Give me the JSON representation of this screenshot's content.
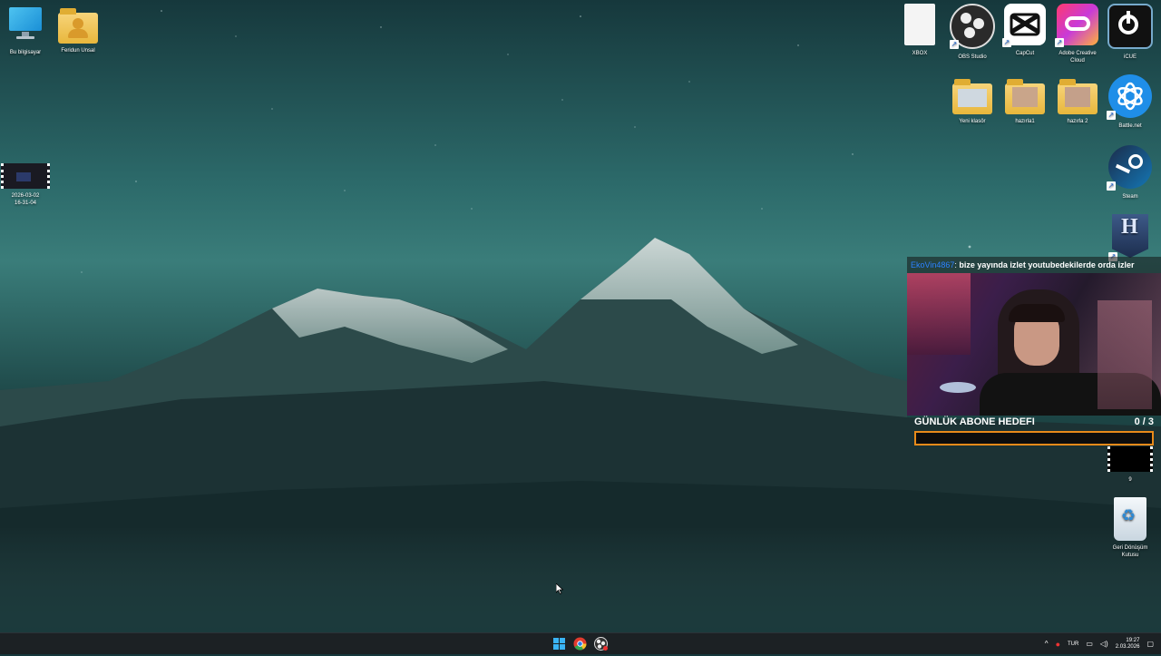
{
  "desktop": {
    "left_icons": [
      {
        "label": "Bu bilgisayar",
        "icon": "monitor-icon"
      },
      {
        "label": "Feridun Unsal",
        "icon": "user-folder-icon"
      },
      {
        "label_line1": "2026-03-02",
        "label_line2": "16-31-04",
        "icon": "video-thumbnail-icon"
      }
    ],
    "right_icons": {
      "xbox": "XBOX",
      "obs": "OBS Studio",
      "capcut": "CapCut",
      "adobe": "Adobe Creative Cloud",
      "icue": "iCUE",
      "yeni_klasor": "Yeni klasör",
      "hazirla1": "hazırla1",
      "hazirla2": "hazırla 2",
      "battlenet": "Battle.net",
      "steam": "Steam",
      "hytale": "",
      "video9": "9",
      "recycle": "Geri Dönüşüm Kutusu"
    }
  },
  "overlay": {
    "chat_user": "EkoVin4867",
    "chat_sep": ": ",
    "chat_message": "bize yayında izlet youtubedekilerde orda izler",
    "goal_title": "GÜNLÜK ABONE HEDEFI",
    "goal_count": "0 / 3",
    "goal_current": 0,
    "goal_target": 3,
    "accent_color": "#e88a1a"
  },
  "taskbar": {
    "apps": [
      "start-icon",
      "chrome-icon",
      "obs-tray-icon"
    ],
    "tray": {
      "lang": "TUR",
      "time": "19:27",
      "date": "2.03.2026"
    }
  }
}
